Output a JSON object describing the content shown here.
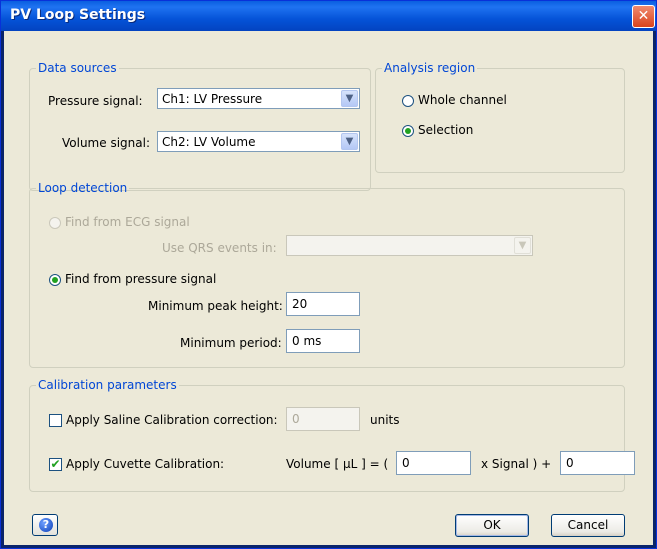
{
  "window": {
    "title": "PV Loop Settings",
    "close_symbol": "✕"
  },
  "data_sources": {
    "legend": "Data sources",
    "pressure_label": "Pressure signal:",
    "pressure_value": "Ch1: LV Pressure",
    "volume_label": "Volume signal:",
    "volume_value": "Ch2: LV Volume"
  },
  "analysis_region": {
    "legend": "Analysis region",
    "option_whole": "Whole channel",
    "option_selection": "Selection",
    "selected": "Selection"
  },
  "loop_detection": {
    "legend": "Loop detection",
    "ecg_option": "Find from ECG signal",
    "qrs_label": "Use QRS events in:",
    "qrs_value": "",
    "pressure_option": "Find from pressure signal",
    "min_peak_label": "Minimum peak height:",
    "min_peak_value": "20",
    "min_period_label": "Minimum period:",
    "min_period_value": "0 ms"
  },
  "calibration": {
    "legend": "Calibration parameters",
    "saline_label": "Apply Saline Calibration correction:",
    "saline_checked": false,
    "saline_value": "0",
    "saline_units": "units",
    "cuvette_label": "Apply Cuvette Calibration:",
    "cuvette_checked": true,
    "formula_prefix": "Volume [ µL ] = (",
    "coef_value": "0",
    "formula_mid": "x Signal ) +",
    "offset_value": "0"
  },
  "buttons": {
    "help": "?",
    "ok": "OK",
    "cancel": "Cancel"
  },
  "check_glyph": "✔",
  "arrow_glyph": "▼",
  "colors": {
    "legend": "#0046d5",
    "title_bar": "#0553d8",
    "dialog_bg": "#ece9d8"
  }
}
